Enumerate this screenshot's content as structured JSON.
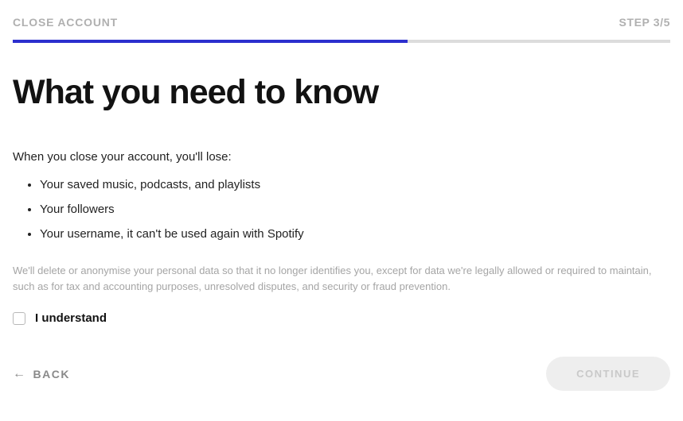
{
  "header": {
    "title": "CLOSE ACCOUNT",
    "step": "STEP 3/5"
  },
  "progress": {
    "percent": 60
  },
  "main": {
    "title": "What you need to know",
    "intro": "When you close your account, you'll lose:",
    "lose_items": [
      "Your saved music, podcasts, and playlists",
      "Your followers",
      "Your username, it can't be used again with Spotify"
    ],
    "legal": "We'll delete or anonymise your personal data so that it no longer identifies you, except for data we're legally allowed or required to maintain, such as for tax and accounting purposes, unresolved disputes, and security or fraud prevention.",
    "checkbox_label": "I understand"
  },
  "footer": {
    "back": "BACK",
    "continue": "CONTINUE"
  }
}
